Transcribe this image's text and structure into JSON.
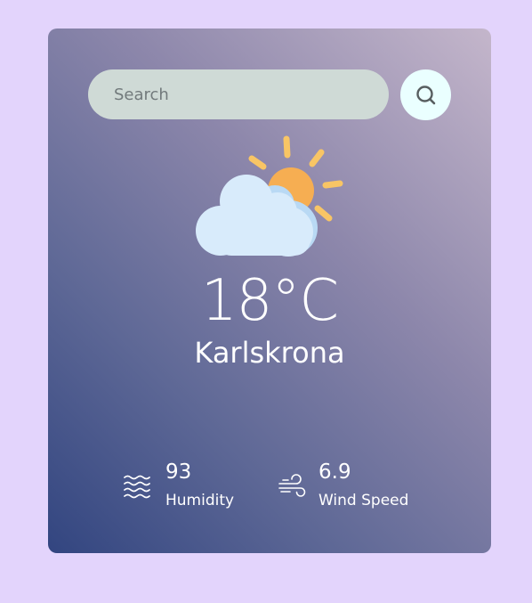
{
  "search": {
    "placeholder": "Search",
    "value": "",
    "button_icon": "search-icon"
  },
  "weather": {
    "icon": "partly-cloudy-icon",
    "temperature": "18°C",
    "city": "Karlskrona"
  },
  "stats": {
    "humidity": {
      "icon": "humidity-waves-icon",
      "value": "93",
      "label": "Humidity"
    },
    "wind": {
      "icon": "wind-icon",
      "value": "6.9",
      "label": "Wind Speed"
    }
  },
  "colors": {
    "page_background": "#e3d4fc",
    "card_gradient_start": "#324580",
    "card_gradient_end": "#c4b6cb",
    "search_bar": "#cfdad6",
    "search_button": "#eaffff",
    "sun": "#f6ae52",
    "sun_rays": "#f8c565",
    "cloud": "#d8ebfb"
  }
}
